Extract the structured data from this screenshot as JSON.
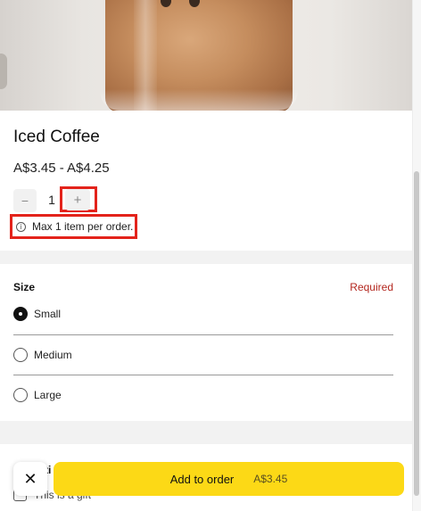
{
  "product": {
    "title": "Iced Coffee",
    "price_range": "A$3.45 - A$4.25"
  },
  "quantity": {
    "value": "1",
    "decrement_symbol": "−",
    "increment_symbol": "+"
  },
  "notice": {
    "icon": "info-icon",
    "text": "Max 1 item per order."
  },
  "size": {
    "label": "Size",
    "required_label": "Required",
    "options": [
      {
        "label": "Small",
        "selected": true
      },
      {
        "label": "Medium",
        "selected": false
      },
      {
        "label": "Large",
        "selected": false
      }
    ]
  },
  "extras": {
    "heading": "ti",
    "gift_label": "This is a gift"
  },
  "footer": {
    "close_symbol": "✕",
    "add_label": "Add to order",
    "add_price": "A$3.45"
  },
  "colors": {
    "accent_yellow": "#fcd916",
    "required_red": "#b3261e",
    "highlight_red": "#e3231b"
  }
}
